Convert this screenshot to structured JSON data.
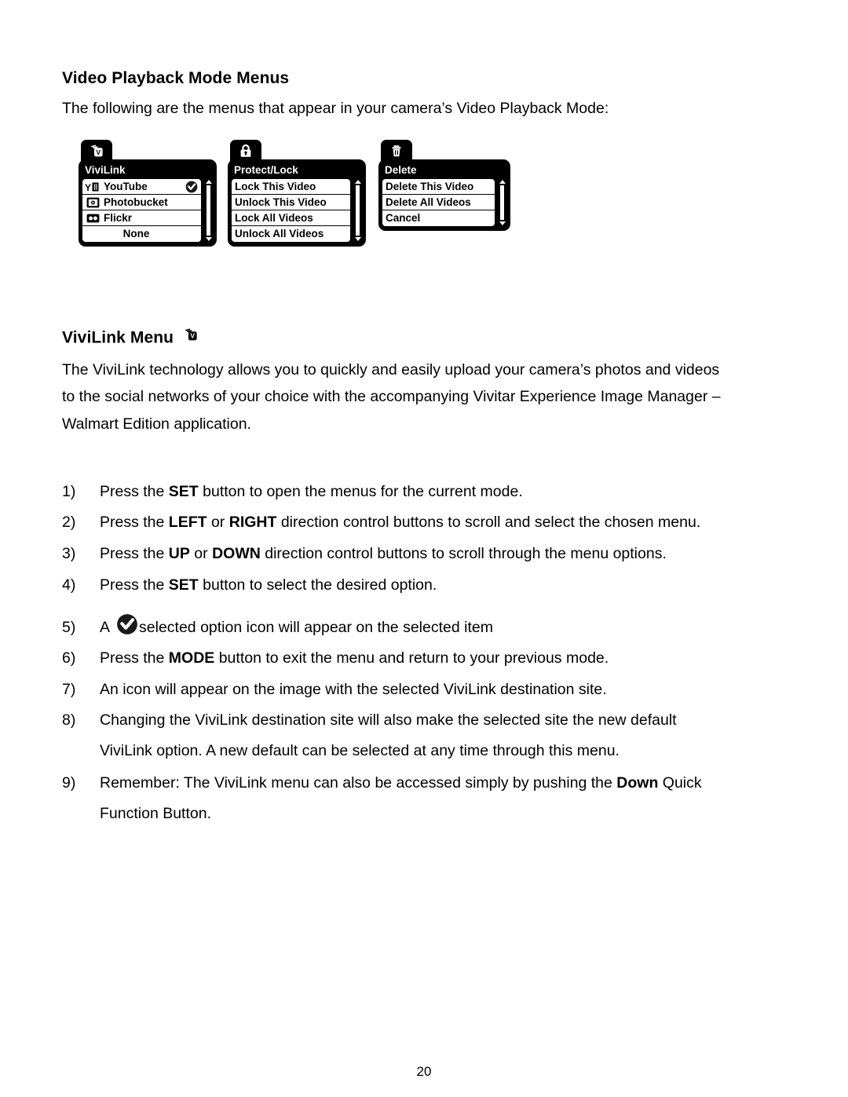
{
  "document": {
    "page_number": "20"
  },
  "sections": {
    "video_playback": {
      "heading": "Video Playback Mode Menus",
      "intro": "The following are the menus that appear in your camera’s Video Playback Mode:"
    },
    "vivilink": {
      "heading": "ViviLink Menu",
      "heading_icon": "vivilink-cards-icon",
      "paragraph_lines": [
        "The ViviLink technology allows you to quickly and easily upload your camera’s photos and videos",
        "to the social networks of your choice with the accompanying Vivitar Experience Image Manager –",
        "Walmart Edition application."
      ]
    }
  },
  "camera_menus": [
    {
      "id": "vivilink",
      "tab_icon": "vivilink-cards-icon",
      "title": "ViviLink",
      "scrollbar": true,
      "rows": [
        {
          "icon": "youtube-icon",
          "label": "YouTube",
          "selected": true,
          "centered": false
        },
        {
          "icon": "photobucket-icon",
          "label": "Photobucket",
          "selected": false,
          "centered": false
        },
        {
          "icon": "flickr-icon",
          "label": "Flickr",
          "selected": false,
          "centered": false
        },
        {
          "icon": "",
          "label": "None",
          "selected": false,
          "centered": true
        }
      ]
    },
    {
      "id": "protect-lock",
      "tab_icon": "lock-icon",
      "title": "Protect/Lock",
      "scrollbar": true,
      "rows": [
        {
          "icon": "",
          "label": "Lock This Video",
          "selected": false,
          "centered": false
        },
        {
          "icon": "",
          "label": "Unlock This Video",
          "selected": false,
          "centered": false
        },
        {
          "icon": "",
          "label": "Lock All Videos",
          "selected": false,
          "centered": false
        },
        {
          "icon": "",
          "label": "Unlock All Videos",
          "selected": false,
          "centered": false
        }
      ]
    },
    {
      "id": "delete",
      "tab_icon": "trash-icon",
      "title": "Delete",
      "scrollbar": true,
      "rows": [
        {
          "icon": "",
          "label": "Delete This Video",
          "selected": false,
          "centered": false
        },
        {
          "icon": "",
          "label": "Delete All Videos",
          "selected": false,
          "centered": false
        },
        {
          "icon": "",
          "label": "Cancel",
          "selected": false,
          "centered": false
        }
      ]
    }
  ],
  "steps": [
    {
      "num": "1)",
      "parts": [
        {
          "t": "Press the ",
          "b": false
        },
        {
          "t": "SET",
          "b": true
        },
        {
          "t": " button to open the menus for the current mode.",
          "b": false
        }
      ]
    },
    {
      "num": "2)",
      "parts": [
        {
          "t": "Press the ",
          "b": false
        },
        {
          "t": "LEFT",
          "b": true
        },
        {
          "t": " or ",
          "b": false
        },
        {
          "t": "RIGHT",
          "b": true
        },
        {
          "t": " direction control buttons to scroll and select the chosen menu.",
          "b": false
        }
      ]
    },
    {
      "num": "3)",
      "parts": [
        {
          "t": "Press the ",
          "b": false
        },
        {
          "t": "UP",
          "b": true
        },
        {
          "t": " or ",
          "b": false
        },
        {
          "t": "DOWN",
          "b": true
        },
        {
          "t": " direction control buttons to scroll through the menu options.",
          "b": false
        }
      ]
    },
    {
      "num": "4)",
      "parts": [
        {
          "t": "Press the ",
          "b": false
        },
        {
          "t": "SET",
          "b": true
        },
        {
          "t": " button to select the desired option.",
          "b": false
        }
      ]
    },
    {
      "num": "5)",
      "icon_after_index": 0,
      "icon": "selected-check-icon",
      "parts": [
        {
          "t": "A",
          "b": false
        },
        {
          "t": "selected option icon will appear on the selected item",
          "b": false
        }
      ]
    },
    {
      "num": "6)",
      "parts": [
        {
          "t": "Press the ",
          "b": false
        },
        {
          "t": "MODE",
          "b": true
        },
        {
          "t": " button to exit the menu and return to your previous mode.",
          "b": false
        }
      ]
    },
    {
      "num": "7)",
      "parts": [
        {
          "t": "An icon will appear on the image with the selected ViviLink destination site.",
          "b": false
        }
      ]
    },
    {
      "num": "8)",
      "parts": [
        {
          "t": "Changing the ViviLink destination site will also make the selected site the new default",
          "b": false
        }
      ],
      "continuation": "ViviLink option. A new default can be selected at any time through this menu."
    },
    {
      "num": "9)",
      "parts": [
        {
          "t": "Remember: The ViviLink menu can also be accessed simply by pushing the ",
          "b": false
        },
        {
          "t": "Down",
          "b": true
        },
        {
          "t": " Quick",
          "b": false
        }
      ],
      "continuation": "Function Button."
    }
  ],
  "colors": {
    "page_background": "#ffffff",
    "text": "#000000",
    "menu_background": "#000000",
    "menu_row_background": "#ffffff"
  }
}
